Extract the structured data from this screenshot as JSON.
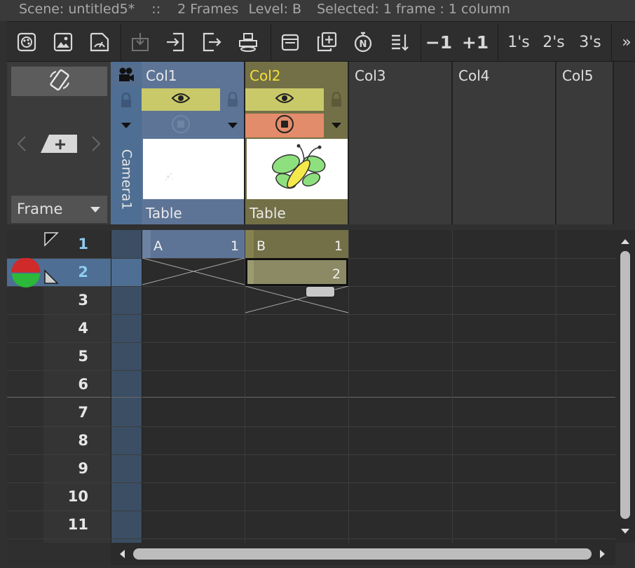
{
  "titlebar": {
    "scene": "Scene: untitled5*",
    "sep": "::",
    "frames": "2 Frames",
    "level": "Level: B",
    "selected": "Selected: 1 frame : 1 column"
  },
  "toolbar": {
    "minus_one": "−1",
    "plus_one": "+1",
    "ones": "1's",
    "twos": "2's",
    "threes": "3's",
    "more": "»"
  },
  "left_panel": {
    "frame_mode": "Frame"
  },
  "camera_column": {
    "label": "Camera1"
  },
  "columns": [
    {
      "name": "Col1",
      "pegbar": "Table",
      "cell_level": "A",
      "cell_frame": "1",
      "name_color": "#e8e8e8"
    },
    {
      "name": "Col2",
      "pegbar": "Table",
      "cell_level": "B",
      "cell_frame": "1",
      "cell_frame2": "2",
      "name_color": "#f3e03a"
    },
    {
      "name": "Col3"
    },
    {
      "name": "Col4"
    },
    {
      "name": "Col5"
    }
  ],
  "rows": [
    "1",
    "2",
    "3",
    "4",
    "5",
    "6",
    "7",
    "8",
    "9",
    "10",
    "11"
  ],
  "colors": {
    "col1_header": "#5d7496",
    "col2_header": "#737047",
    "preview_on": "#c9c96a",
    "camstand_on": "#e38c6b",
    "camera_column": "#4e6e93",
    "current_row": "#4e6e93",
    "onion_red": "#d02a2a",
    "onion_green": "#2cb83a"
  },
  "icons": [
    "palette-icon",
    "image-icon",
    "gauge-icon",
    "collapse-icon",
    "import-icon",
    "export-icon",
    "viewer-icon",
    "window-icon",
    "duplicate-icon",
    "stopwatch-icon",
    "sort-icon",
    "eye-icon",
    "lock-icon",
    "camstand-icon",
    "camera-icon",
    "rotate-icon",
    "add-key-icon"
  ]
}
